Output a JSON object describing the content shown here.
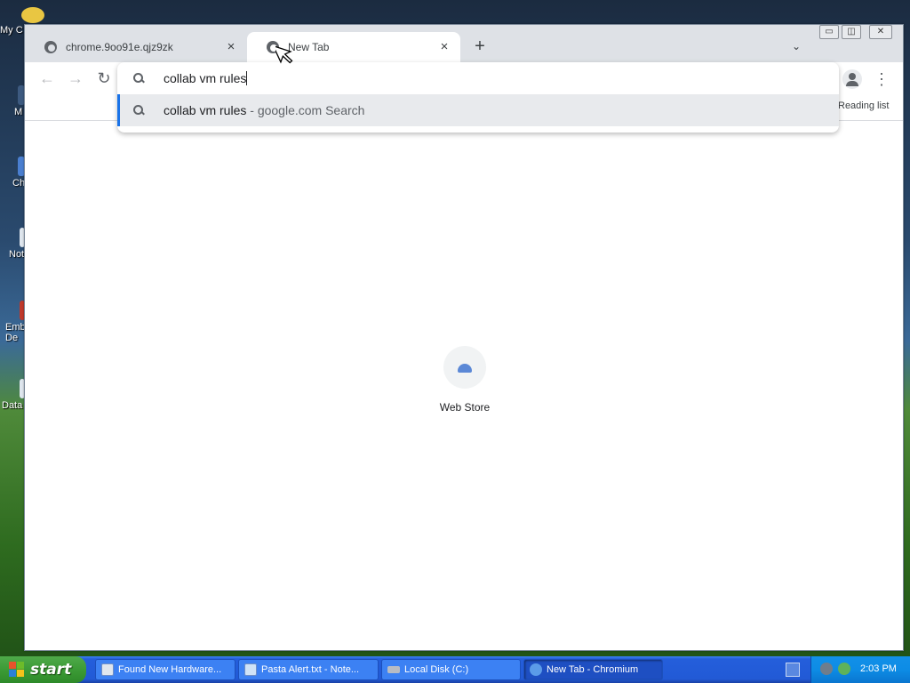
{
  "desktop": {
    "icons": [
      {
        "label": "My C"
      },
      {
        "label": "M"
      },
      {
        "label": "Ch"
      },
      {
        "label": "Not"
      },
      {
        "label": "Emb De"
      },
      {
        "label": "Data"
      }
    ]
  },
  "browser": {
    "tabs": [
      {
        "title": "chrome.9oo91e.qjz9zk",
        "active": false
      },
      {
        "title": "New Tab",
        "active": true
      }
    ],
    "close_icon": "×",
    "new_tab_icon": "+",
    "tab_search_icon": "⌄",
    "window_buttons": {
      "minimize": "▭",
      "restore": "◫",
      "close": "✕"
    },
    "toolbar": {
      "back": "←",
      "forward": "→",
      "reload": "↻",
      "menu": "⋮"
    },
    "omnibox": {
      "input_value": "collab vm rules",
      "suggestion": {
        "query": "collab vm rules",
        "separator": " - ",
        "source": "google.com Search"
      }
    },
    "bookmarks_bar": {
      "reading_list": "Reading list"
    },
    "ntp": {
      "shortcut_label": "Web Store"
    }
  },
  "taskbar": {
    "start_label": "start",
    "tasks": [
      {
        "label": "Found New Hardware...",
        "active": false
      },
      {
        "label": "Pasta Alert.txt - Note...",
        "active": false
      },
      {
        "label": "Local Disk (C:)",
        "active": false
      },
      {
        "label": "New Tab - Chromium",
        "active": true
      }
    ],
    "clock": "2:03 PM"
  },
  "colors": {
    "accent": "#1a73e8",
    "taskbar": "#245edb",
    "start_button": "#3c9b36"
  }
}
